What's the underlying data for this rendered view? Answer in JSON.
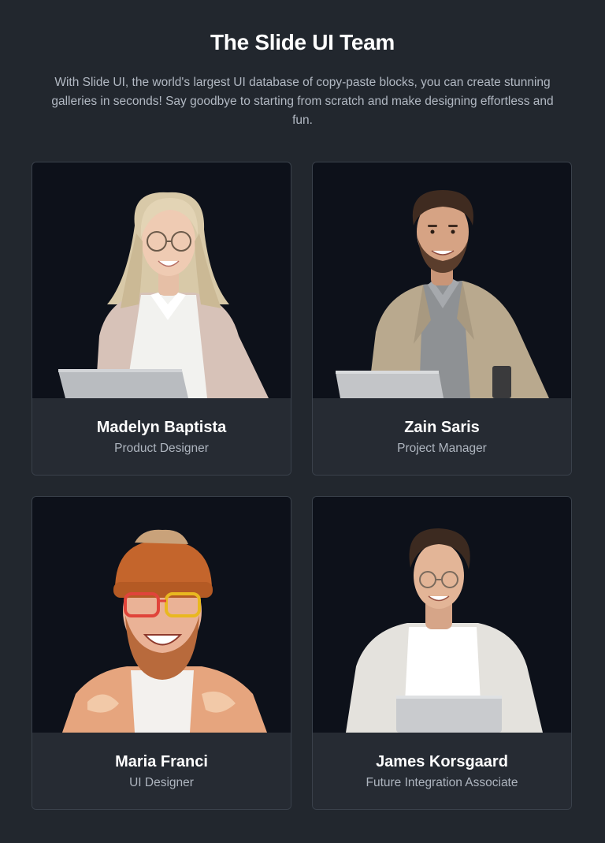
{
  "header": {
    "title": "The Slide UI Team",
    "description": "With Slide UI, the world's largest UI database of copy-paste blocks, you can create stunning galleries in seconds! Say goodbye to starting from scratch and make designing effortless and fun."
  },
  "team": [
    {
      "name": "Madelyn Baptista",
      "role": "Product Designer",
      "photo_icon": "woman-glasses-laptop-portrait"
    },
    {
      "name": "Zain Saris",
      "role": "Project Manager",
      "photo_icon": "man-jacket-laptop-portrait"
    },
    {
      "name": "Maria Franci",
      "role": "UI Designer",
      "photo_icon": "bearded-man-beanie-portrait"
    },
    {
      "name": "James Korsgaard",
      "role": "Future Integration Associate",
      "photo_icon": "man-glasses-laptop-portrait"
    }
  ],
  "colors": {
    "background": "#22272e",
    "card": "#262b33",
    "card_border": "#3a414b",
    "photo_background": "#0d111a",
    "title": "#ffffff",
    "muted_text": "#aeb5bf"
  }
}
